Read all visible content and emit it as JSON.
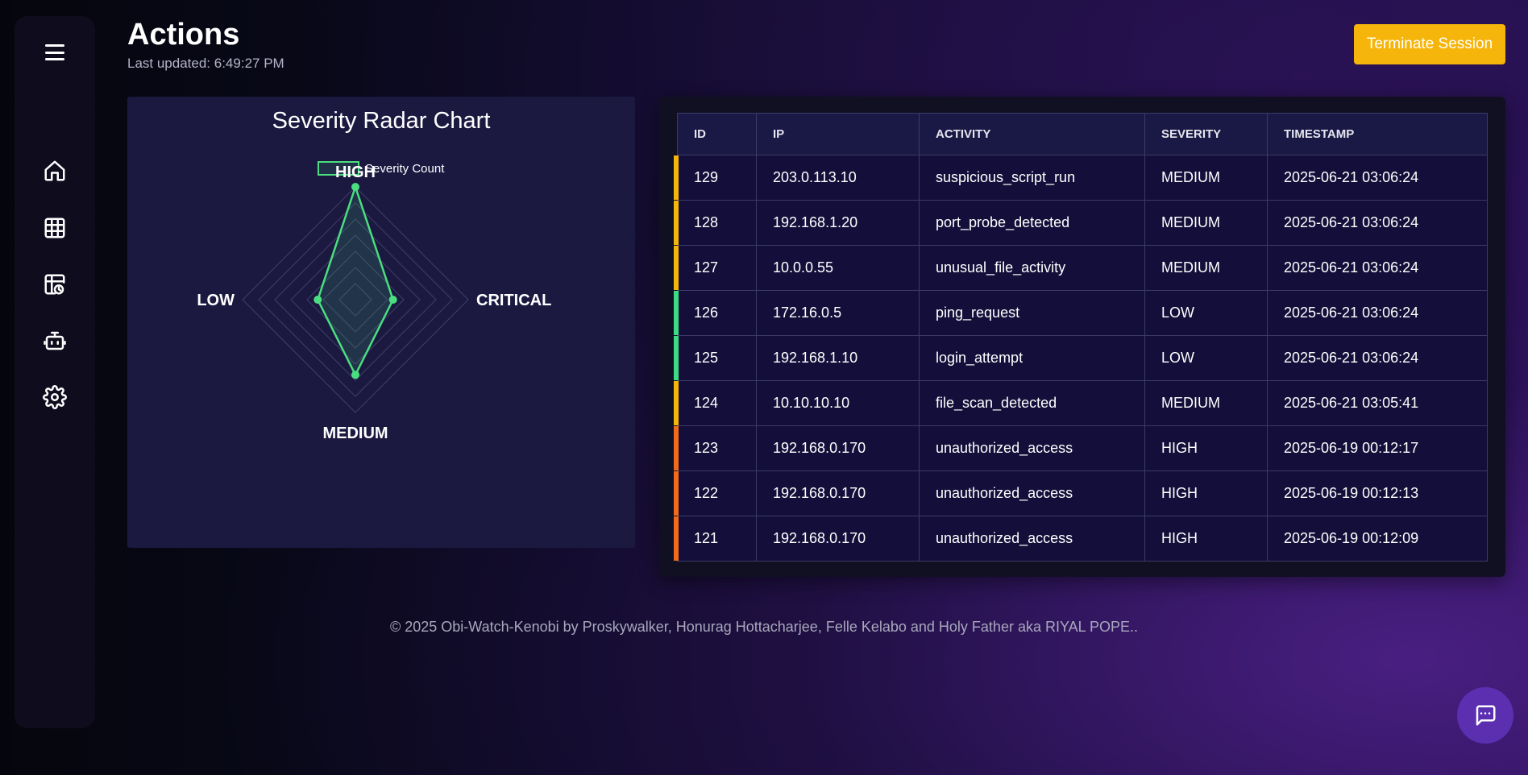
{
  "header": {
    "title": "Actions",
    "last_updated": "Last updated: 6:49:27 PM",
    "terminate_label": "Terminate Session",
    "terminate_color": "#f5b50a"
  },
  "sidebar": {
    "items": [
      {
        "icon": "home-icon"
      },
      {
        "icon": "grid-icon"
      },
      {
        "icon": "report-icon"
      },
      {
        "icon": "robot-icon"
      },
      {
        "icon": "gear-icon"
      }
    ]
  },
  "chart": {
    "title": "Severity Radar Chart",
    "legend_label": "Severity Count",
    "line_color": "#4ade80"
  },
  "chart_data": {
    "type": "radar",
    "title": "Severity Radar Chart",
    "axes": [
      "HIGH",
      "CRITICAL",
      "MEDIUM",
      "LOW"
    ],
    "series": [
      {
        "name": "Severity Count",
        "values": [
          3,
          1,
          2,
          1
        ]
      }
    ],
    "rlim": [
      0,
      3
    ],
    "rings": 7
  },
  "table": {
    "columns": [
      "ID",
      "IP",
      "ACTIVITY",
      "SEVERITY",
      "TIMESTAMP"
    ],
    "rows": [
      {
        "id": "129",
        "ip": "203.0.113.10",
        "activity": "suspicious_script_run",
        "severity": "MEDIUM",
        "timestamp": "2025-06-21 03:06:24"
      },
      {
        "id": "128",
        "ip": "192.168.1.20",
        "activity": "port_probe_detected",
        "severity": "MEDIUM",
        "timestamp": "2025-06-21 03:06:24"
      },
      {
        "id": "127",
        "ip": "10.0.0.55",
        "activity": "unusual_file_activity",
        "severity": "MEDIUM",
        "timestamp": "2025-06-21 03:06:24"
      },
      {
        "id": "126",
        "ip": "172.16.0.5",
        "activity": "ping_request",
        "severity": "LOW",
        "timestamp": "2025-06-21 03:06:24"
      },
      {
        "id": "125",
        "ip": "192.168.1.10",
        "activity": "login_attempt",
        "severity": "LOW",
        "timestamp": "2025-06-21 03:06:24"
      },
      {
        "id": "124",
        "ip": "10.10.10.10",
        "activity": "file_scan_detected",
        "severity": "MEDIUM",
        "timestamp": "2025-06-21 03:05:41"
      },
      {
        "id": "123",
        "ip": "192.168.0.170",
        "activity": "unauthorized_access",
        "severity": "HIGH",
        "timestamp": "2025-06-19 00:12:17"
      },
      {
        "id": "122",
        "ip": "192.168.0.170",
        "activity": "unauthorized_access",
        "severity": "HIGH",
        "timestamp": "2025-06-19 00:12:13"
      },
      {
        "id": "121",
        "ip": "192.168.0.170",
        "activity": "unauthorized_access",
        "severity": "HIGH",
        "timestamp": "2025-06-19 00:12:09"
      }
    ],
    "severity_colors": {
      "LOW": "#3ddc84",
      "MEDIUM": "#f5b50a",
      "HIGH": "#f26b1d"
    }
  },
  "footer": {
    "text": "© 2025 Obi-Watch-Kenobi by Proskywalker, Honurag Hottacharjee, Felle Kelabo and Holy Father aka RIYAL POPE.."
  },
  "chat": {
    "icon": "chat-icon"
  }
}
